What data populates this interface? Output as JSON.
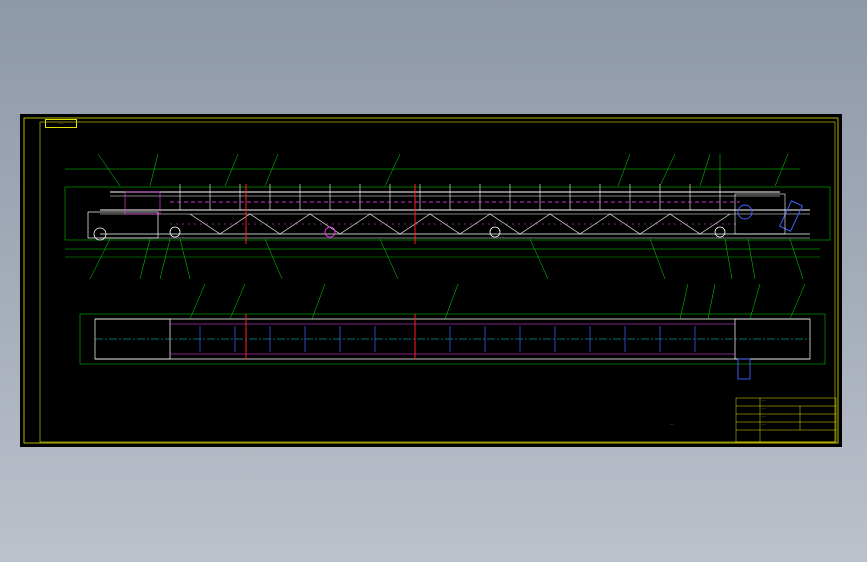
{
  "colors": {
    "desktop_top": "#8d98a8",
    "viewport": "#000000",
    "frame": "#e0e000",
    "structure": "#ffffff",
    "leader": "#00e000",
    "rollers": "#ff40ff",
    "motor": "#4060ff",
    "cut_line": "#ff2020",
    "centerline": "#00e0e0"
  },
  "drawing": {
    "tag": "···",
    "note": "···",
    "title_block": {
      "line1": "···",
      "line2": "···",
      "line3": "···",
      "line4": "···"
    }
  }
}
